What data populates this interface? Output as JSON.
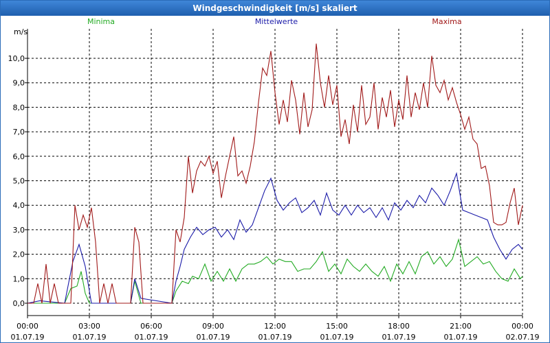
{
  "window": {
    "title": "Windgeschwindigkeit [m/s] skaliert"
  },
  "colors": {
    "min": "#22aa22",
    "mean": "#1a1aa8",
    "max": "#a01818",
    "grid": "#000000",
    "title_bar": "#2a6bb8"
  },
  "chart_data": {
    "type": "line",
    "title": "Windgeschwindigkeit [m/s] skaliert",
    "ylabel": "m/s",
    "xlabel": "",
    "ylim": [
      0,
      11
    ],
    "xlim": [
      0,
      24
    ],
    "grid": true,
    "legend_position": "top",
    "y_ticks": [
      "0,0",
      "1,0",
      "2,0",
      "3,0",
      "4,0",
      "5,0",
      "6,0",
      "7,0",
      "8,0",
      "9,0",
      "10,0"
    ],
    "x_ticks": [
      {
        "time": "00:00",
        "date": "01.07.19"
      },
      {
        "time": "03:00",
        "date": "01.07.19"
      },
      {
        "time": "06:00",
        "date": "01.07.19"
      },
      {
        "time": "09:00",
        "date": "01.07.19"
      },
      {
        "time": "12:00",
        "date": "01.07.19"
      },
      {
        "time": "15:00",
        "date": "01.07.19"
      },
      {
        "time": "18:00",
        "date": "01.07.19"
      },
      {
        "time": "21:00",
        "date": "01.07.19"
      },
      {
        "time": "00:00",
        "date": "02.07.19"
      }
    ],
    "series": [
      {
        "name": "Minima",
        "color": "#22aa22",
        "points": [
          [
            0,
            0
          ],
          [
            1.8,
            0
          ],
          [
            2.1,
            0.6
          ],
          [
            2.4,
            0.7
          ],
          [
            2.6,
            1.3
          ],
          [
            2.8,
            0.4
          ],
          [
            3.0,
            0
          ],
          [
            5.0,
            0
          ],
          [
            5.2,
            0.9
          ],
          [
            5.5,
            0
          ],
          [
            7.0,
            0
          ],
          [
            7.2,
            0.5
          ],
          [
            7.5,
            0.9
          ],
          [
            7.8,
            0.8
          ],
          [
            8.0,
            1.1
          ],
          [
            8.3,
            1.0
          ],
          [
            8.6,
            1.6
          ],
          [
            8.9,
            0.9
          ],
          [
            9.2,
            1.3
          ],
          [
            9.5,
            0.9
          ],
          [
            9.8,
            1.4
          ],
          [
            10.1,
            0.9
          ],
          [
            10.4,
            1.4
          ],
          [
            10.7,
            1.6
          ],
          [
            11.0,
            1.6
          ],
          [
            11.3,
            1.7
          ],
          [
            11.6,
            1.9
          ],
          [
            11.9,
            1.6
          ],
          [
            12.2,
            1.8
          ],
          [
            12.5,
            1.7
          ],
          [
            12.8,
            1.7
          ],
          [
            13.1,
            1.3
          ],
          [
            13.4,
            1.4
          ],
          [
            13.7,
            1.4
          ],
          [
            14.0,
            1.7
          ],
          [
            14.3,
            2.1
          ],
          [
            14.6,
            1.3
          ],
          [
            14.9,
            1.6
          ],
          [
            15.2,
            1.2
          ],
          [
            15.5,
            1.8
          ],
          [
            15.8,
            1.5
          ],
          [
            16.1,
            1.3
          ],
          [
            16.4,
            1.6
          ],
          [
            16.7,
            1.3
          ],
          [
            17.0,
            1.1
          ],
          [
            17.3,
            1.5
          ],
          [
            17.6,
            0.9
          ],
          [
            17.9,
            1.6
          ],
          [
            18.2,
            1.2
          ],
          [
            18.5,
            1.7
          ],
          [
            18.8,
            1.2
          ],
          [
            19.1,
            1.9
          ],
          [
            19.4,
            2.1
          ],
          [
            19.7,
            1.6
          ],
          [
            20.0,
            1.9
          ],
          [
            20.3,
            1.5
          ],
          [
            20.6,
            1.8
          ],
          [
            20.9,
            2.6
          ],
          [
            21.2,
            1.5
          ],
          [
            21.5,
            1.7
          ],
          [
            21.8,
            1.9
          ],
          [
            22.1,
            1.6
          ],
          [
            22.4,
            1.7
          ],
          [
            22.7,
            1.3
          ],
          [
            23.0,
            1.0
          ],
          [
            23.3,
            0.9
          ],
          [
            23.6,
            1.4
          ],
          [
            23.9,
            1.0
          ],
          [
            24.0,
            1.1
          ]
        ]
      },
      {
        "name": "Mittelwerte",
        "color": "#1a1aa8",
        "points": [
          [
            0,
            0
          ],
          [
            0.6,
            0.1
          ],
          [
            1.8,
            0
          ],
          [
            2.2,
            1.7
          ],
          [
            2.5,
            2.4
          ],
          [
            2.8,
            1.5
          ],
          [
            3.1,
            0
          ],
          [
            5.0,
            0
          ],
          [
            5.2,
            1.0
          ],
          [
            5.5,
            0.2
          ],
          [
            7.0,
            0
          ],
          [
            7.2,
            0.9
          ],
          [
            7.4,
            1.5
          ],
          [
            7.6,
            2.2
          ],
          [
            7.9,
            2.7
          ],
          [
            8.2,
            3.1
          ],
          [
            8.5,
            2.8
          ],
          [
            8.8,
            3.0
          ],
          [
            9.1,
            3.1
          ],
          [
            9.4,
            2.7
          ],
          [
            9.7,
            3.0
          ],
          [
            10.0,
            2.6
          ],
          [
            10.3,
            3.4
          ],
          [
            10.6,
            2.9
          ],
          [
            10.9,
            3.2
          ],
          [
            11.2,
            3.9
          ],
          [
            11.5,
            4.6
          ],
          [
            11.8,
            5.1
          ],
          [
            12.1,
            4.2
          ],
          [
            12.4,
            3.8
          ],
          [
            12.7,
            4.1
          ],
          [
            13.0,
            4.3
          ],
          [
            13.3,
            3.7
          ],
          [
            13.6,
            3.9
          ],
          [
            13.9,
            4.2
          ],
          [
            14.2,
            3.6
          ],
          [
            14.5,
            4.5
          ],
          [
            14.8,
            3.8
          ],
          [
            15.1,
            3.6
          ],
          [
            15.4,
            4.0
          ],
          [
            15.7,
            3.6
          ],
          [
            16.0,
            4.0
          ],
          [
            16.3,
            3.7
          ],
          [
            16.6,
            3.9
          ],
          [
            16.9,
            3.5
          ],
          [
            17.2,
            3.9
          ],
          [
            17.5,
            3.4
          ],
          [
            17.8,
            4.1
          ],
          [
            18.1,
            3.8
          ],
          [
            18.4,
            4.2
          ],
          [
            18.7,
            3.9
          ],
          [
            19.0,
            4.4
          ],
          [
            19.3,
            4.1
          ],
          [
            19.6,
            4.7
          ],
          [
            19.9,
            4.4
          ],
          [
            20.2,
            4.0
          ],
          [
            20.5,
            4.6
          ],
          [
            20.8,
            5.3
          ],
          [
            21.1,
            3.8
          ],
          [
            21.4,
            3.7
          ],
          [
            21.7,
            3.6
          ],
          [
            22.0,
            3.5
          ],
          [
            22.3,
            3.4
          ],
          [
            22.6,
            2.7
          ],
          [
            22.9,
            2.2
          ],
          [
            23.2,
            1.8
          ],
          [
            23.5,
            2.2
          ],
          [
            23.8,
            2.4
          ],
          [
            24.0,
            2.2
          ]
        ]
      },
      {
        "name": "Maxima",
        "color": "#a01818",
        "points": [
          [
            0,
            0
          ],
          [
            0.3,
            0
          ],
          [
            0.5,
            0.8
          ],
          [
            0.7,
            0
          ],
          [
            0.9,
            1.6
          ],
          [
            1.1,
            0
          ],
          [
            1.3,
            0.8
          ],
          [
            1.5,
            0
          ],
          [
            2.1,
            0
          ],
          [
            2.3,
            4.0
          ],
          [
            2.5,
            3.0
          ],
          [
            2.7,
            3.6
          ],
          [
            2.9,
            3.1
          ],
          [
            3.1,
            3.9
          ],
          [
            3.3,
            2.5
          ],
          [
            3.5,
            0
          ],
          [
            3.7,
            0.8
          ],
          [
            3.9,
            0
          ],
          [
            4.1,
            0.8
          ],
          [
            4.3,
            0
          ],
          [
            5.0,
            0
          ],
          [
            5.2,
            3.1
          ],
          [
            5.4,
            2.5
          ],
          [
            5.6,
            0
          ],
          [
            7.0,
            0
          ],
          [
            7.2,
            3.0
          ],
          [
            7.4,
            2.5
          ],
          [
            7.6,
            3.5
          ],
          [
            7.8,
            6.0
          ],
          [
            8.0,
            4.5
          ],
          [
            8.2,
            5.4
          ],
          [
            8.4,
            5.8
          ],
          [
            8.6,
            5.6
          ],
          [
            8.8,
            6.0
          ],
          [
            9.0,
            5.3
          ],
          [
            9.2,
            5.8
          ],
          [
            9.4,
            4.3
          ],
          [
            9.6,
            5.2
          ],
          [
            9.8,
            6.0
          ],
          [
            10.0,
            6.8
          ],
          [
            10.2,
            5.2
          ],
          [
            10.4,
            5.4
          ],
          [
            10.6,
            4.9
          ],
          [
            10.8,
            5.6
          ],
          [
            11.0,
            6.6
          ],
          [
            11.2,
            8.2
          ],
          [
            11.4,
            9.6
          ],
          [
            11.6,
            9.3
          ],
          [
            11.8,
            10.3
          ],
          [
            12.0,
            8.6
          ],
          [
            12.2,
            7.3
          ],
          [
            12.4,
            8.3
          ],
          [
            12.6,
            7.4
          ],
          [
            12.8,
            9.1
          ],
          [
            13.0,
            8.3
          ],
          [
            13.2,
            6.9
          ],
          [
            13.4,
            8.6
          ],
          [
            13.6,
            7.2
          ],
          [
            13.8,
            7.9
          ],
          [
            14.0,
            10.6
          ],
          [
            14.2,
            9.0
          ],
          [
            14.4,
            8.0
          ],
          [
            14.6,
            9.3
          ],
          [
            14.8,
            8.1
          ],
          [
            15.0,
            8.9
          ],
          [
            15.2,
            6.8
          ],
          [
            15.4,
            7.5
          ],
          [
            15.6,
            6.5
          ],
          [
            15.8,
            8.1
          ],
          [
            16.0,
            7.0
          ],
          [
            16.2,
            8.9
          ],
          [
            16.4,
            7.3
          ],
          [
            16.6,
            7.6
          ],
          [
            16.8,
            9.0
          ],
          [
            17.0,
            7.1
          ],
          [
            17.2,
            8.4
          ],
          [
            17.4,
            7.6
          ],
          [
            17.6,
            8.7
          ],
          [
            17.8,
            7.2
          ],
          [
            18.0,
            8.3
          ],
          [
            18.2,
            7.5
          ],
          [
            18.4,
            9.3
          ],
          [
            18.6,
            7.6
          ],
          [
            18.8,
            8.6
          ],
          [
            19.0,
            7.9
          ],
          [
            19.2,
            9.0
          ],
          [
            19.4,
            8.0
          ],
          [
            19.6,
            10.1
          ],
          [
            19.8,
            8.9
          ],
          [
            20.0,
            8.6
          ],
          [
            20.2,
            9.1
          ],
          [
            20.4,
            8.3
          ],
          [
            20.6,
            8.8
          ],
          [
            20.8,
            8.2
          ],
          [
            21.0,
            7.7
          ],
          [
            21.2,
            7.1
          ],
          [
            21.4,
            7.6
          ],
          [
            21.6,
            6.7
          ],
          [
            21.8,
            6.5
          ],
          [
            22.0,
            5.5
          ],
          [
            22.2,
            5.6
          ],
          [
            22.4,
            4.8
          ],
          [
            22.6,
            3.3
          ],
          [
            22.8,
            3.2
          ],
          [
            23.0,
            3.2
          ],
          [
            23.2,
            3.3
          ],
          [
            23.4,
            4.1
          ],
          [
            23.6,
            4.7
          ],
          [
            23.8,
            3.2
          ],
          [
            24.0,
            4.0
          ]
        ]
      }
    ]
  }
}
